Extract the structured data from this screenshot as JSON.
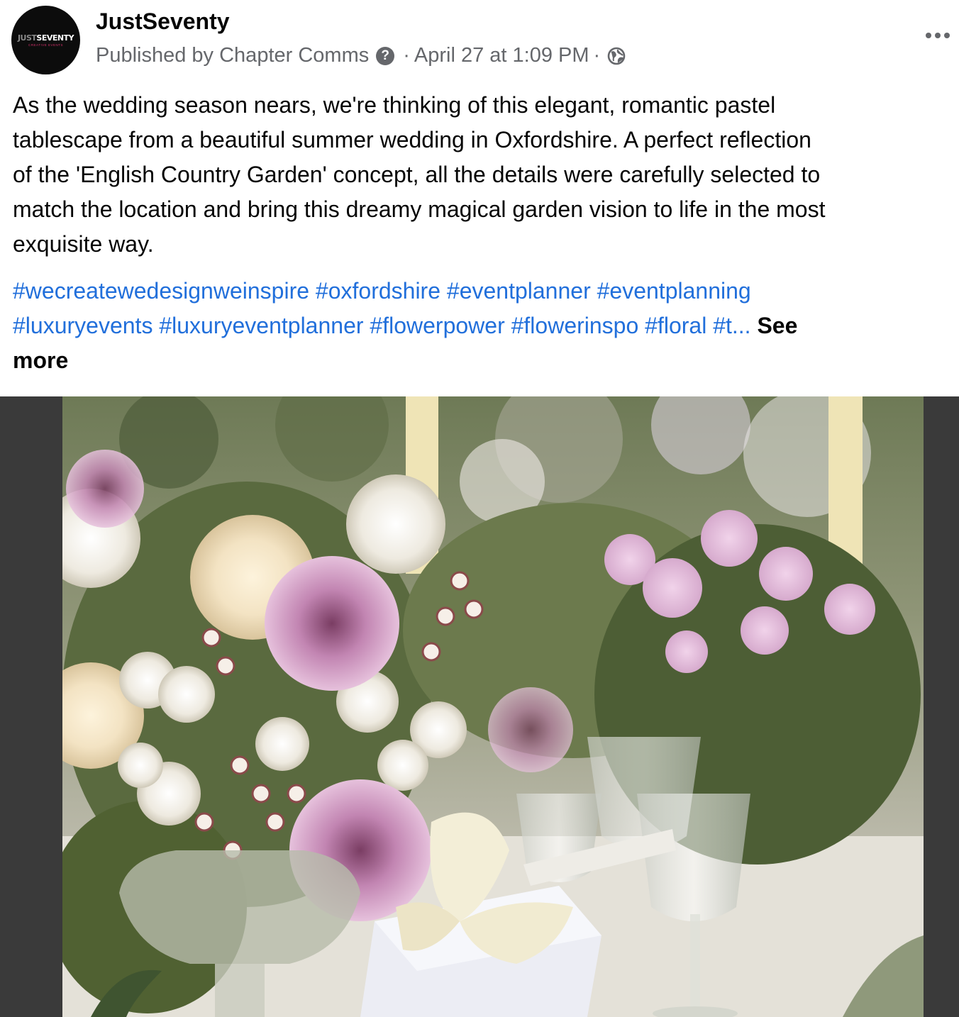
{
  "post": {
    "page_name": "JustSeventy",
    "avatar": {
      "logo_dim": "JUST",
      "logo_main": "SEVENTY",
      "logo_sub": "CREATIVE EVENTS"
    },
    "meta": {
      "published_by": "Published by Chapter Comms",
      "separator": "·",
      "date": "April 27 at 1:09 PM",
      "audience_icon": "globe-icon",
      "help_icon": "question-mark-icon"
    },
    "more_icon": "horizontal-ellipsis-icon",
    "text_lines": [
      "As the wedding season nears, we're thinking of this elegant, romantic pastel",
      "tablescape from a beautiful summer wedding in Oxfordshire. A perfect reflection",
      "of the 'English Country Garden' concept, all the details were carefully selected to",
      "match the location and bring this dreamy magical garden vision to life in the most",
      "exquisite way."
    ],
    "hashtags": {
      "line1": [
        "#wecreatewedesignweinspire",
        "#oxfordshire",
        "#eventplanner",
        "#eventplanning"
      ],
      "line2": [
        "#luxuryevents",
        "#luxuryeventplanner",
        "#flowerpower",
        "#flowerinspo",
        "#floral",
        "#t..."
      ],
      "see_more_1": "See",
      "see_more_2": "more"
    },
    "colors": {
      "link": "#216fdb",
      "secondary_text": "#65676b",
      "primary_text": "#050505",
      "photo_letterbox": "#3a3a3a"
    }
  }
}
